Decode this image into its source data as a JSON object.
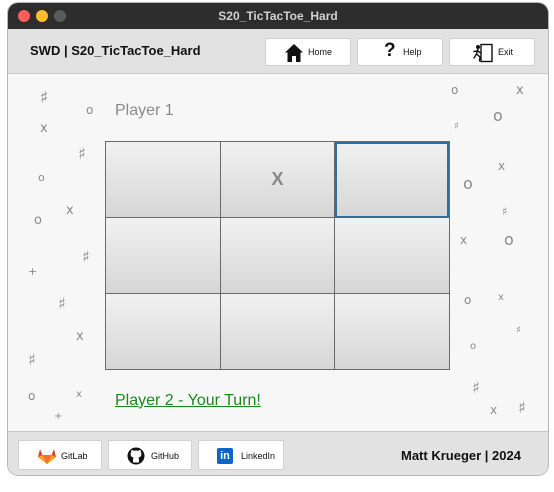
{
  "window": {
    "title": "S20_TicTacToe_Hard"
  },
  "header": {
    "app_name": "SWD | S20_TicTacToe_Hard",
    "home_label": "Home",
    "help_label": "Help",
    "exit_label": "Exit"
  },
  "game": {
    "player_label": "Player 1",
    "board": [
      [
        "",
        "X",
        ""
      ],
      [
        "",
        "",
        ""
      ],
      [
        "",
        "",
        ""
      ]
    ],
    "turn_text": "Player 2 - Your Turn!"
  },
  "footer": {
    "gitlab_label": "GitLab",
    "github_label": "GitHub",
    "linkedin_label": "LinkedIn",
    "linkedin_glyph": "in",
    "credit": "Matt Krueger | 2024"
  },
  "decorations": {
    "symbols": [
      "♯",
      "o",
      "x",
      "♯",
      "o",
      "x",
      "o",
      "+",
      "♯",
      "♯",
      "x",
      "♯",
      "o",
      "x",
      "+",
      "o",
      "x",
      "o",
      "♯",
      "x",
      "o",
      "♯",
      "x",
      "o",
      "o",
      "x",
      "♯",
      "o",
      "♯",
      "x",
      "♯"
    ]
  },
  "colors": {
    "titlebar": "#2d2d2d",
    "turn_text": "#1a8a1a",
    "focus_outline": "#2e6f9b",
    "gitlab": "#e24329",
    "linkedin": "#0a66c2"
  }
}
